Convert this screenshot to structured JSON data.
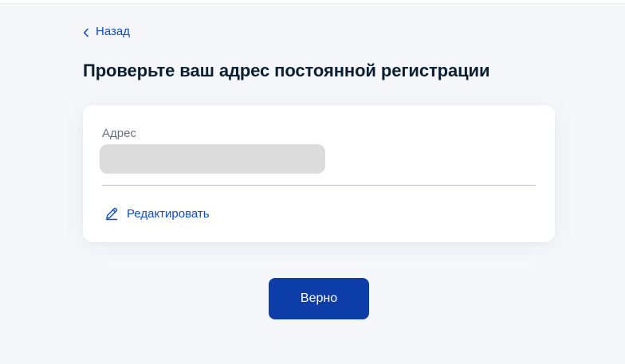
{
  "nav": {
    "back_label": "Назад"
  },
  "page": {
    "title": "Проверьте ваш адрес постоянной регистрации"
  },
  "address_card": {
    "field_label": "Адрес",
    "field_value": "",
    "edit_label": "Редактировать"
  },
  "actions": {
    "confirm_label": "Верно"
  },
  "icons": {
    "back": "chevron-left-icon",
    "edit": "pencil-icon"
  },
  "colors": {
    "accent": "#0d4cd3",
    "primary_button": "#0d3da8",
    "title": "#0b1f33",
    "label": "#66727f",
    "background": "#f5f7fb"
  }
}
